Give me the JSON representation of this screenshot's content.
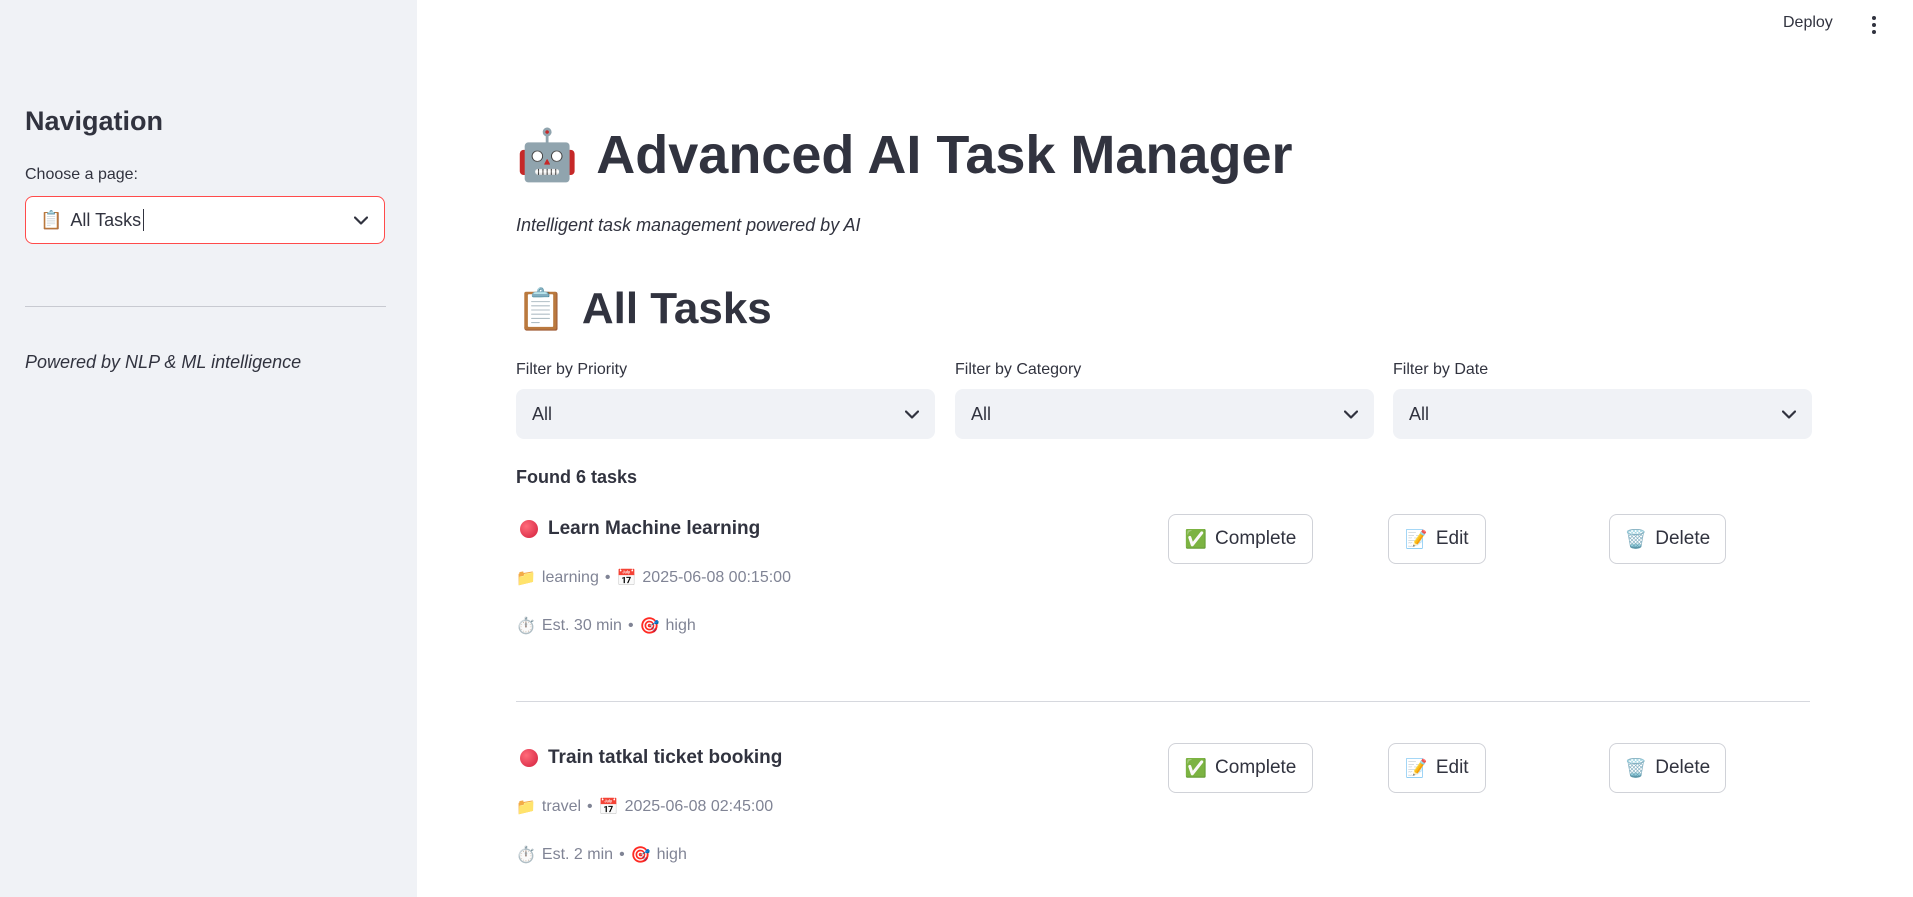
{
  "sidebar": {
    "heading": "Navigation",
    "select_label": "Choose a page:",
    "select_icon": "📋",
    "select_value": "All Tasks",
    "caption": "Powered by NLP & ML intelligence"
  },
  "topbar": {
    "deploy_label": "Deploy"
  },
  "header": {
    "title_icon": "🤖",
    "title": "Advanced AI Task Manager",
    "subtitle": "Intelligent task management powered by AI"
  },
  "section": {
    "icon": "📋",
    "title": "All Tasks"
  },
  "filters": [
    {
      "label": "Filter by Priority",
      "value": "All"
    },
    {
      "label": "Filter by Category",
      "value": "All"
    },
    {
      "label": "Filter by Date",
      "value": "All"
    }
  ],
  "found_text": "Found 6 tasks",
  "buttons": {
    "complete_icon": "✅",
    "complete": "Complete",
    "edit_icon": "📝",
    "edit": "Edit",
    "delete_icon": "🗑️",
    "delete": "Delete"
  },
  "meta_icons": {
    "folder": "📁",
    "calendar": "📅",
    "timer": "⏱️",
    "target": "🎯",
    "separator": "•"
  },
  "tasks": [
    {
      "title": "Learn Machine learning",
      "category": "learning",
      "due": "2025-06-08 00:15:00",
      "estimate": "Est. 30 min",
      "priority": "high"
    },
    {
      "title": "Train tatkal ticket booking",
      "category": "travel",
      "due": "2025-06-08 02:45:00",
      "estimate": "Est. 2 min",
      "priority": "high"
    }
  ]
}
